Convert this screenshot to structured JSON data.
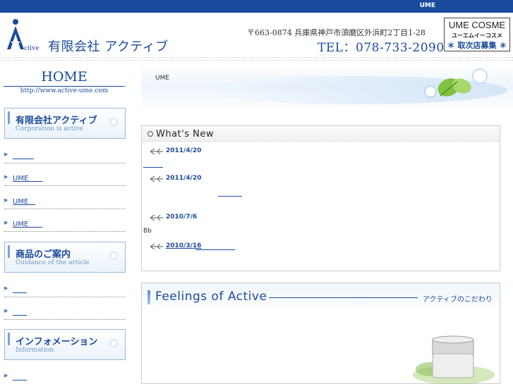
{
  "topbar": {
    "text": "UME"
  },
  "header": {
    "logo_text": "ctive",
    "company_name": "有限会社 アクティブ",
    "address": "〒663-0874 兵庫県神戸市須磨区外浜町2丁目1-28",
    "tel": "TEL：078-733-2090",
    "cosme": {
      "title": "UME COSME",
      "kana": "ユーエムイーコスメ",
      "link_label": "＊ 取次店募集 ＊"
    }
  },
  "sidebar": {
    "home_title": "HOME",
    "home_url": "http://www.active-ume.com",
    "sections": [
      {
        "title": "有限会社アクティブ",
        "sub": "Corporation is active",
        "items": [
          "　　　",
          "UME　　",
          "UME　",
          "UME　　"
        ]
      },
      {
        "title": "商品のご案内",
        "sub": "Guidance of the article",
        "items": [
          "　　",
          "　　"
        ]
      },
      {
        "title": "インフォメーション",
        "sub": "Information",
        "items": [
          "　　"
        ]
      }
    ]
  },
  "banner": {
    "text": "UME"
  },
  "whats_new": {
    "title": "What's New",
    "items": [
      {
        "date": "2011/4/20",
        "text": ""
      },
      {
        "date": "2011/4/20",
        "text": ""
      },
      {
        "date": "2010/7/6",
        "text": "Bb"
      },
      {
        "date": "2010/3/16",
        "text": ""
      }
    ]
  },
  "feelings": {
    "title": "Feelings of Active",
    "subtitle": "アクティブのこだわり"
  },
  "colors": {
    "brand_blue": "#1a4a9c",
    "topbar": "#1a4a9c",
    "accent_light": "#9bb8d8"
  }
}
